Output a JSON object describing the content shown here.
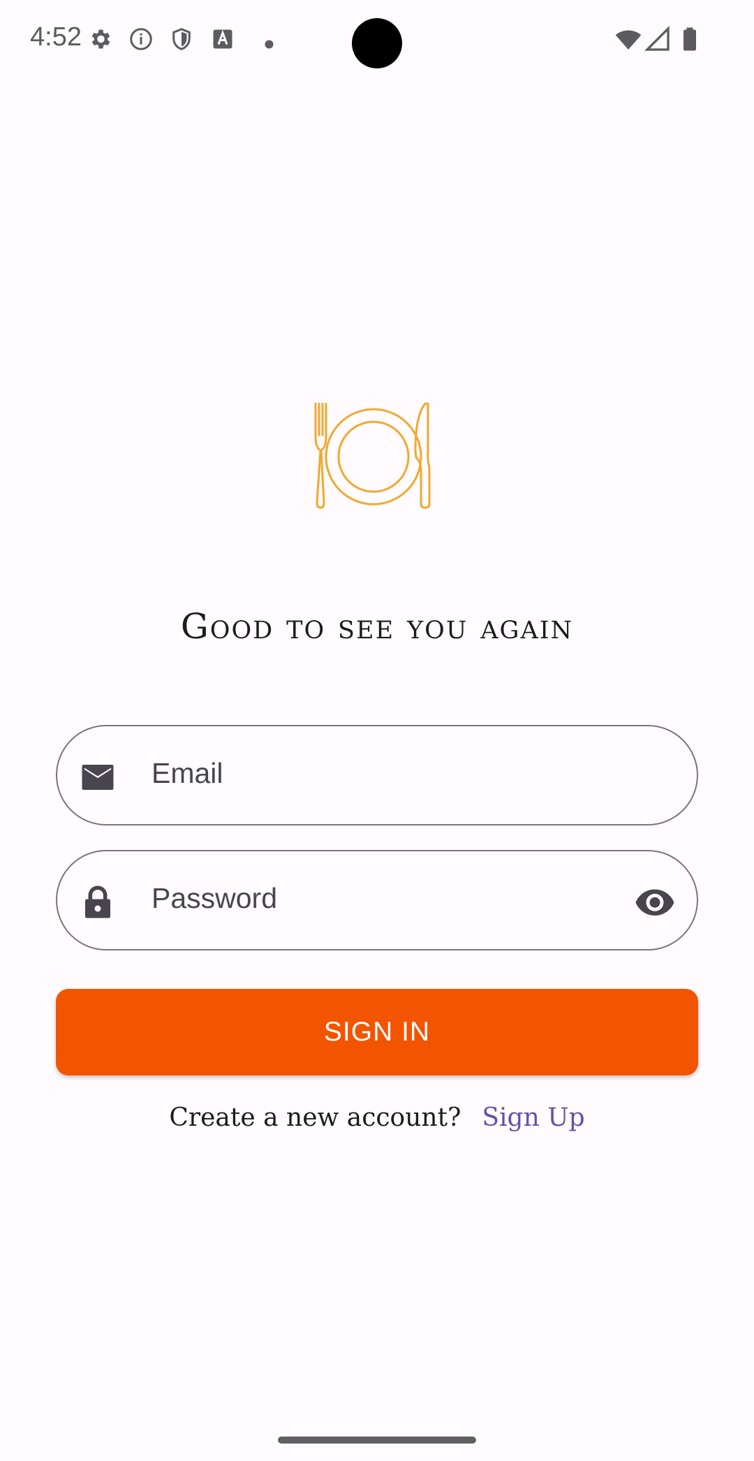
{
  "status_bar": {
    "time": "4:52",
    "left_icons": [
      "gear-icon",
      "info-icon",
      "shield-icon",
      "keyboard-a-icon",
      "dot-icon"
    ],
    "right_icons": [
      "wifi-icon",
      "signal-icon",
      "battery-icon"
    ]
  },
  "logo": {
    "icon": "plate-fork-knife-icon",
    "color": "#f2a830"
  },
  "welcome": {
    "title": "Good to see you again"
  },
  "form": {
    "email": {
      "icon": "mail-icon",
      "placeholder": "Email"
    },
    "password": {
      "icon": "lock-icon",
      "placeholder": "Password",
      "toggle_icon": "eye-icon"
    },
    "sign_in_label": "SIGN IN",
    "sign_in_color": "#f25400"
  },
  "signup": {
    "question": "Create a new account?",
    "link_label": "Sign Up",
    "link_color": "#6750a4"
  }
}
